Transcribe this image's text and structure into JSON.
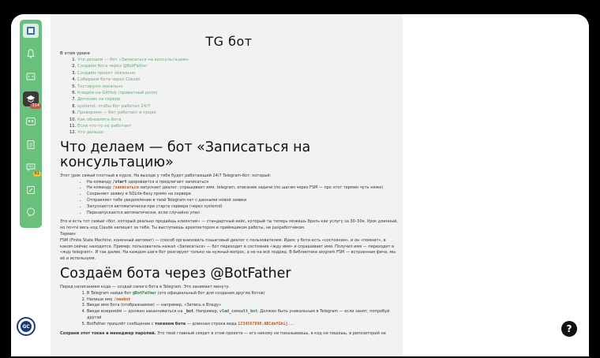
{
  "title": "TG бот",
  "toc": {
    "heading": "В этом уроке",
    "items": [
      "Что делаем — бот «Записаться на консультацию»",
      "Создаём бота через @BotFather",
      "Создаём проект локально",
      "Собираем бота через Claude",
      "Тестируем локально",
      "Кладём на GitHub (приватный репо)",
      "Деплоим на сервер",
      "systemd: чтобы бот работал 24/7",
      "Проверяем — бот работает в проде",
      "Как обновлять бота",
      "Если что-то не работает",
      "Что дальше"
    ]
  },
  "section1": {
    "heading": "Что делаем — бот «Записаться на консультацию»",
    "intro": "Этот урок самый плотный в курсе. На выходе у тебя будет работающий 24/7 Telegram-бот, который:",
    "bullets": [
      {
        "pre": "На команду ",
        "code": "/start",
        "post": " здоровается и предлагает записаться"
      },
      {
        "pre": "На команду ",
        "code": "/записаться",
        "post": " запускает диалог: спрашивает имя, telegram, описание задачи (по шагам через FSM — про этот термин чуть ниже)"
      },
      {
        "pre": "Сохраняет заявку в SQLite-базу прямо на сервере",
        "code": "",
        "post": ""
      },
      {
        "pre": "Отправляет тебе уведомление в твой Telegram-чат с данными новой заявки",
        "code": "",
        "post": ""
      },
      {
        "pre": "Запускается автоматически при старте сервера (через systemd)",
        "code": "",
        "post": ""
      },
      {
        "pre": "Перезапускается автоматически, если случайно упал",
        "code": "",
        "post": ""
      }
    ],
    "para2": "Это и есть тот самый «бот, который реально продаёшь клиентам» — стандартный кейс, который ты теперь можешь брать как услугу за 30–50к. Урок длинный, но почти весь код Claude напишет за тебя. Ты выступаешь архитектором и приёмщиком работы, не разработчиком.",
    "term_label": "Термин",
    "para3": "FSM (Finite State Machine, конечный автомат) — способ организовать пошаговый диалог с пользователем. Идея: у бота есть «состояния», и он «помнит», в каком сейчас находится. Пример: пользователь нажал «Записаться» — бот переходит в состояние «жду имя» и спрашивает имя. Получил имя — переходит в «жду telegram». И так далее. На каждом шаге бот реагирует только на нужный вопрос, а не на всё подряд. В библиотеке aiogram FSM — встроенная фича, мы её и используем."
  },
  "section2": {
    "heading": "Создаём бота через @BotFather",
    "intro": "Перед написанием кода — создай самого бота в Telegram. Это занимает минуту.",
    "steps": [
      {
        "pre": "В Telegram найди бот ",
        "code": "@BotFather",
        "post": " (это официальный бот для создания других ботов)"
      },
      {
        "pre": "Напиши ему ",
        "code": "/newbot",
        "post": ""
      },
      {
        "pre": "Введи имя бота (отображаемое) — например, «Запись к Владу»",
        "code": "",
        "post": ""
      },
      {
        "pre": "Введи юзернейм — должен заканчиваться на ",
        "code": "_bot",
        "post": ". Например, ",
        "code2": "vlad_consult_bot",
        "post2": ". Должен быть уникальным в Telegram — если занят, попробуй другой"
      },
      {
        "pre": "BotFather пришлёт сообщение с ",
        "bold": "токеном бота",
        "post": " — длинная строка вида ",
        "code": "1234567890:ABCdefGhij...",
        "code_after": true
      }
    ],
    "warning_bold": "Сохрани этот токен в менеджер паролей.",
    "warning_rest": " Это твой главный секрет в этом проекте — его никому не показываешь, в код не пишешь, в репозиторий не"
  },
  "logo_text": "GC",
  "help_text": "?",
  "colors": {
    "rail": "#6abf7b",
    "link": "#6aaa78",
    "accent": "#c0561c"
  }
}
